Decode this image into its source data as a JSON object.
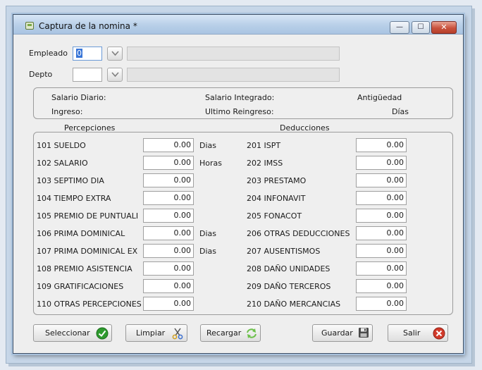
{
  "window": {
    "title": "Captura de la nomina *",
    "controls": {
      "minimize": "—",
      "maximize": "☐",
      "close": "✕"
    }
  },
  "employee": {
    "label": "Empleado",
    "value": "0",
    "name": ""
  },
  "department": {
    "label": "Depto",
    "value": "",
    "name": ""
  },
  "info": {
    "salario_diario": "Salario Diario:",
    "salario_integrado": "Salario Integrado:",
    "antiguedad": "Antigüedad",
    "ingreso": "Ingreso:",
    "ultimo_reingreso": "Ultimo Reingreso:",
    "dias": "Días"
  },
  "percepciones": {
    "header": "Percepciones",
    "rows": [
      {
        "label": "101 SUELDO",
        "value": "0.00",
        "unit": "Dias"
      },
      {
        "label": "102 SALARIO",
        "value": "0.00",
        "unit": "Horas"
      },
      {
        "label": "103 SEPTIMO DIA",
        "value": "0.00",
        "unit": ""
      },
      {
        "label": "104 TIEMPO EXTRA",
        "value": "0.00",
        "unit": ""
      },
      {
        "label": "105 PREMIO DE PUNTUALI",
        "value": "0.00",
        "unit": ""
      },
      {
        "label": "106 PRIMA DOMINICAL",
        "value": "0.00",
        "unit": "Dias"
      },
      {
        "label": "107 PRIMA DOMINICAL EX",
        "value": "0.00",
        "unit": "Dias"
      },
      {
        "label": "108 PREMIO ASISTENCIA",
        "value": "0.00",
        "unit": ""
      },
      {
        "label": "109 GRATIFICACIONES",
        "value": "0.00",
        "unit": ""
      },
      {
        "label": "110 OTRAS PERCEPCIONES",
        "value": "0.00",
        "unit": ""
      }
    ]
  },
  "deducciones": {
    "header": "Deducciones",
    "rows": [
      {
        "label": "201 ISPT",
        "value": "0.00"
      },
      {
        "label": "202 IMSS",
        "value": "0.00"
      },
      {
        "label": "203 PRESTAMO",
        "value": "0.00"
      },
      {
        "label": "204 INFONAVIT",
        "value": "0.00"
      },
      {
        "label": "205 FONACOT",
        "value": "0.00"
      },
      {
        "label": "206 OTRAS DEDUCCIONES",
        "value": "0.00"
      },
      {
        "label": "207 AUSENTISMOS",
        "value": "0.00"
      },
      {
        "label": "208 DAÑO UNIDADES",
        "value": "0.00"
      },
      {
        "label": "209 DAÑO TERCEROS",
        "value": "0.00"
      },
      {
        "label": "210 DAÑO MERCANCIAS",
        "value": "0.00"
      }
    ]
  },
  "buttons": {
    "seleccionar": "Seleccionar",
    "limpiar": "Limpiar",
    "recargar": "Recargar",
    "guardar": "Guardar",
    "salir": "Salir"
  },
  "icons": {
    "app": "window-app-icon",
    "dropdown": "chevron-down-icon",
    "seleccionar": "check-circle-icon",
    "limpiar": "scissors-icon",
    "recargar": "refresh-arrows-icon",
    "guardar": "floppy-disk-icon",
    "salir": "close-circle-icon"
  },
  "colors": {
    "accent": "#3875d7",
    "check_green": "#2e9a2e",
    "close_red": "#d23a2a"
  }
}
